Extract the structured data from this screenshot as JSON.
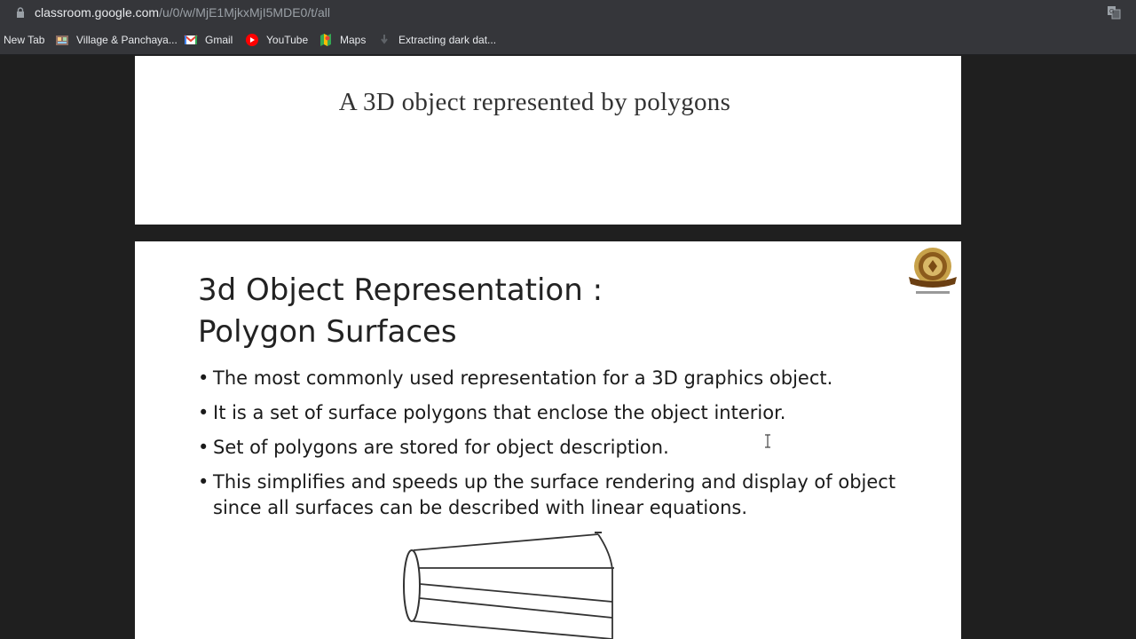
{
  "browser": {
    "url_host": "classroom.google.com",
    "url_path": "/u/0/w/MjE1MjkxMjI5MDE0/t/all"
  },
  "bookmarks": [
    {
      "label": "New Tab",
      "icon": "none"
    },
    {
      "label": "Village & Panchaya...",
      "icon": "village-favicon"
    },
    {
      "label": "Gmail",
      "icon": "gmail-icon"
    },
    {
      "label": "YouTube",
      "icon": "youtube-icon"
    },
    {
      "label": "Maps",
      "icon": "maps-icon"
    },
    {
      "label": "Extracting dark dat...",
      "icon": "page-icon"
    }
  ],
  "slide1": {
    "caption": "A 3D object represented by polygons"
  },
  "slide2": {
    "title_line1": "3d Object Representation :",
    "title_line2": "Polygon Surfaces",
    "bullets": [
      "The most commonly used representation for a 3D graphics object.",
      "It is a set of surface polygons that enclose the object interior.",
      "Set of polygons are stored for object description.",
      "This simplifies and speeds up the surface rendering and display of object since all surfaces can be described with linear equations."
    ],
    "logo_icon": "university-seal-icon"
  },
  "colors": {
    "toolbar": "#35363a",
    "background": "#1f1f1f",
    "slide": "#ffffff"
  }
}
